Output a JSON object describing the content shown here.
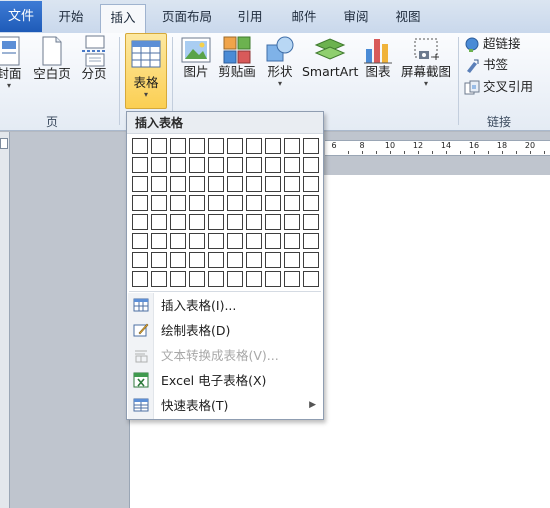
{
  "tabs": {
    "file": "文件",
    "items": [
      {
        "label": "开始",
        "active": false
      },
      {
        "label": "插入",
        "active": true
      },
      {
        "label": "页面布局",
        "active": false
      },
      {
        "label": "引用",
        "active": false
      },
      {
        "label": "邮件",
        "active": false
      },
      {
        "label": "审阅",
        "active": false
      },
      {
        "label": "视图",
        "active": false
      }
    ]
  },
  "ribbon": {
    "pages_group": {
      "cover": "封面",
      "blank_page": "空白页",
      "page_break": "分页",
      "label": "页"
    },
    "table_group": {
      "table": "表格"
    },
    "illustrations": {
      "picture": "图片",
      "clipart": "剪贴画",
      "shapes": "形状",
      "smartart": "SmartArt",
      "chart": "图表",
      "screenshot": "屏幕截图"
    },
    "links_group": {
      "hyperlink": "超链接",
      "bookmark": "书签",
      "cross_ref": "交叉引用",
      "label": "链接"
    }
  },
  "ruler": {
    "numbers": [
      "6",
      "8",
      "10",
      "12",
      "14",
      "16",
      "18",
      "20"
    ]
  },
  "dropdown": {
    "title": "插入表格",
    "grid": {
      "columns": 10,
      "rows": 8
    },
    "items": [
      {
        "label": "插入表格(I)...",
        "icon": "insert-table-icon",
        "disabled": false,
        "submenu": false
      },
      {
        "label": "绘制表格(D)",
        "icon": "draw-table-icon",
        "disabled": false,
        "submenu": false
      },
      {
        "label": "文本转换成表格(V)...",
        "icon": "convert-text-icon",
        "disabled": true,
        "submenu": false
      },
      {
        "label": "Excel 电子表格(X)",
        "icon": "excel-icon",
        "disabled": false,
        "submenu": false
      },
      {
        "label": "快速表格(T)",
        "icon": "quick-table-icon",
        "disabled": false,
        "submenu": true
      }
    ]
  }
}
